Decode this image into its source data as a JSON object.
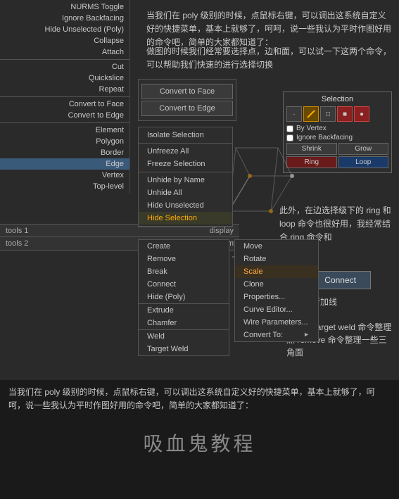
{
  "toolbar": {
    "items": [
      {
        "label": "NURMS Toggle",
        "active": false
      },
      {
        "label": "Ignore Backfacing",
        "active": false
      },
      {
        "label": "Hide Unselected (Poly)",
        "active": false
      },
      {
        "label": "Collapse",
        "active": false
      },
      {
        "label": "Attach",
        "active": false
      },
      {
        "label": "Cut",
        "active": false
      },
      {
        "label": "Quickslice",
        "active": false
      },
      {
        "label": "Repeat",
        "active": false
      },
      {
        "label": "Convert to Face",
        "active": false
      },
      {
        "label": "Convert to Edge",
        "active": false
      },
      {
        "label": "Element",
        "active": false
      },
      {
        "label": "Polygon",
        "active": false
      },
      {
        "label": "Border",
        "active": false
      },
      {
        "label": "Edge",
        "active": true
      },
      {
        "label": "Vertex",
        "active": false
      },
      {
        "label": "Top-level",
        "active": false
      }
    ]
  },
  "convert_panel": {
    "btn1": "Convert to Face",
    "btn2": "Convert to Edge"
  },
  "context_menu": {
    "items": [
      {
        "label": "Isolate Selection",
        "section": 1
      },
      {
        "label": "Unfreeze All",
        "section": 2
      },
      {
        "label": "Freeze Selection",
        "section": 2
      },
      {
        "label": "Unhide by Name",
        "section": 3
      },
      {
        "label": "Unhide All",
        "section": 3
      },
      {
        "label": "Hide Unselected",
        "section": 3
      },
      {
        "label": "Hide Selection",
        "section": 3,
        "highlight": true
      },
      {
        "label": "Create",
        "section": 4
      },
      {
        "label": "Remove",
        "section": 4
      },
      {
        "label": "Break",
        "section": 4
      },
      {
        "label": "Connect",
        "section": 4
      },
      {
        "label": "Hide (Poly)",
        "section": 4
      },
      {
        "label": "Extrude",
        "section": 5
      },
      {
        "label": "Chamfer",
        "section": 5
      },
      {
        "label": "Weld",
        "section": 5
      },
      {
        "label": "Target Weld",
        "section": 5
      }
    ],
    "move_items": [
      {
        "label": "Move"
      },
      {
        "label": "Rotate"
      },
      {
        "label": "Scale",
        "highlight": true
      },
      {
        "label": "Clone"
      },
      {
        "label": "Properties..."
      },
      {
        "label": "Curve Editor..."
      },
      {
        "label": "Wire Parameters..."
      },
      {
        "label": "Convert To:",
        "submenu": true
      }
    ]
  },
  "selection_panel": {
    "title": "Selection",
    "icons": [
      "·",
      "□",
      "▣",
      "■",
      "●"
    ],
    "checkbox1": "By Vertex",
    "checkbox2": "Ignore Backfacing",
    "shrink": "Shrink",
    "grow": "Grow",
    "ring": "Ring",
    "loop": "Loop"
  },
  "connect_btn": "Connect",
  "tools": {
    "tools1": "tools 1",
    "tools2": "tools 2",
    "display": "display",
    "transform": "transform"
  },
  "text_body": "当我们在 poly 级别的时候，点鼠标右键，可以调出这系统自定义好的快捷菜单，基本上就够了，呵呵，说一些我认为平时作图好用的命令吧，简单的大家都知道了：",
  "text_body2": "做图的时候我们经常要选择点，边和面，可以试一下这两个命令，可以帮助我们快速的进行选择切换",
  "text_ring_loop": "此外，在边选择级下的 ring 和 loop 命令也很好用，我经常结合 ring 命令和",
  "text_guide": "命令进行加线",
  "text_weld": "可以用 target weld 命令整理点 remove 命令整理一些三角面",
  "watermark": "吸血鬼教程"
}
